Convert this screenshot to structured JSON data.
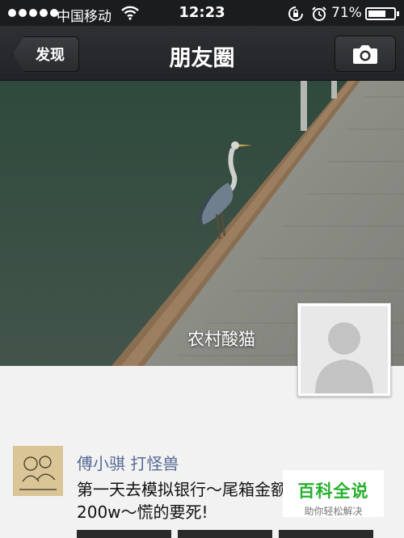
{
  "status_bar": {
    "carrier": "中国移动",
    "time": "12:23",
    "battery": "71%",
    "battery_level": 0.71
  },
  "nav": {
    "back_label": "发现",
    "title": "朋友圈"
  },
  "cover": {
    "username": "农村酸猫"
  },
  "post": {
    "author": "傅小骐 打怪兽",
    "text": "第一天去模拟银行～尾箱金额200w～慌的要死!"
  },
  "watermark": {
    "title": "百科全说",
    "subtitle": "助你轻松解决"
  },
  "colors": {
    "link_blue": "#576b95",
    "brand_green": "#25b12c"
  },
  "icons": [
    "wifi-icon",
    "rotation-lock-icon",
    "alarm-icon",
    "battery-icon",
    "back-arrow-icon",
    "camera-icon",
    "default-avatar-icon"
  ]
}
